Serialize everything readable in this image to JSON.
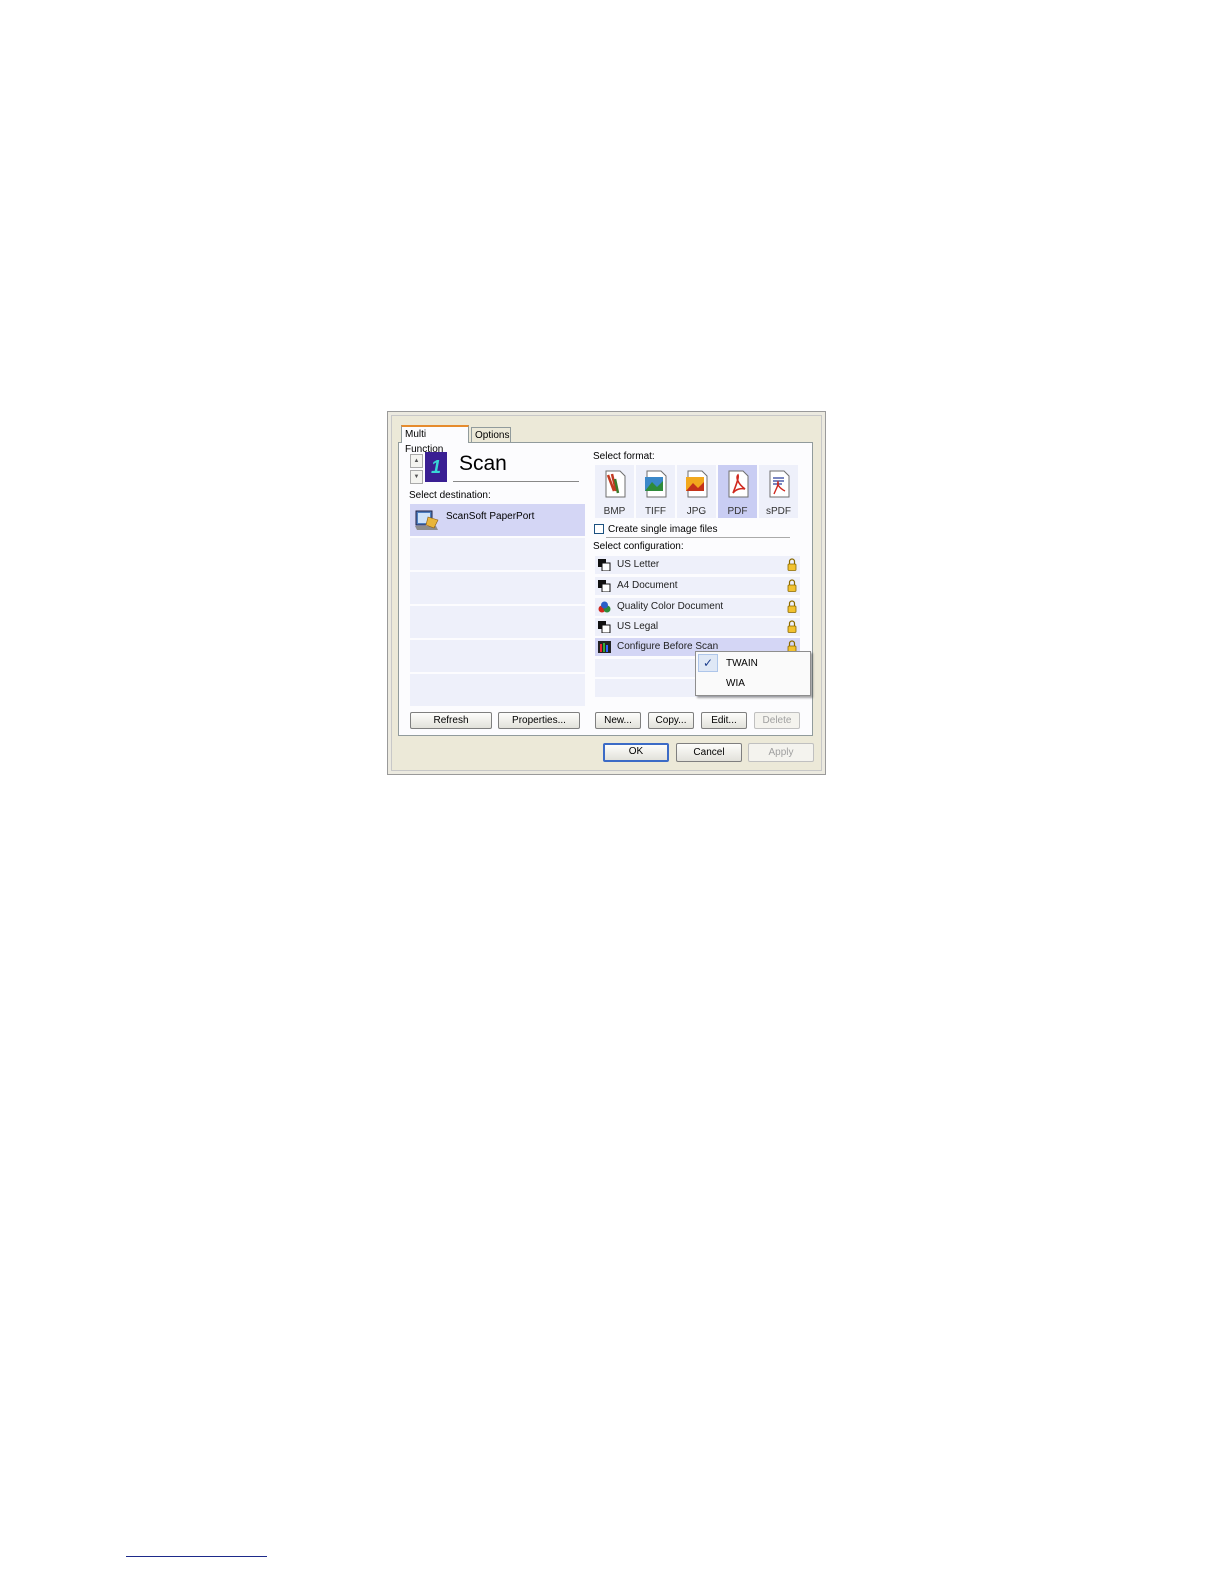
{
  "tabs": [
    "Multi Function",
    "Options"
  ],
  "scan": {
    "title": "Scan",
    "icon_digit": "1"
  },
  "destination": {
    "label": "Select destination:",
    "items": [
      "ScanSoft PaperPort"
    ]
  },
  "format": {
    "label": "Select format:",
    "items": [
      "BMP",
      "TIFF",
      "JPG",
      "PDF",
      "sPDF"
    ],
    "selected": "PDF"
  },
  "single_image": {
    "label": "Create single image files",
    "checked": false
  },
  "configuration": {
    "label": "Select configuration:",
    "items": [
      "US Letter",
      "A4 Document",
      "Quality Color Document",
      "US Legal",
      "Configure Before Scan"
    ],
    "selected": "Configure Before Scan"
  },
  "context_menu": {
    "items": [
      "TWAIN",
      "WIA"
    ],
    "checked": "TWAIN"
  },
  "buttons": {
    "refresh": "Refresh",
    "properties": "Properties...",
    "new": "New...",
    "copy": "Copy...",
    "edit": "Edit...",
    "delete": "Delete",
    "ok": "OK",
    "cancel": "Cancel",
    "apply": "Apply"
  },
  "colors": {
    "selection": "#d4d6f5",
    "row": "#eef0fa",
    "accent": "#3c6bc6"
  }
}
